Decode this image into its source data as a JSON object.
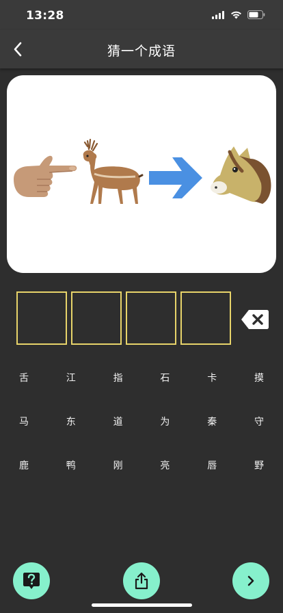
{
  "status": {
    "time": "13:28"
  },
  "nav": {
    "title": "猜一个成语"
  },
  "puzzle": {
    "emojis": [
      "pointing-hand",
      "deer",
      "right-arrow",
      "horse-face"
    ]
  },
  "answer": {
    "slots": [
      "",
      "",
      "",
      ""
    ]
  },
  "characters": {
    "rows": [
      [
        "舌",
        "江",
        "指",
        "石",
        "卡",
        "摸"
      ],
      [
        "马",
        "东",
        "道",
        "为",
        "秦",
        "守"
      ],
      [
        "鹿",
        "鸭",
        "刚",
        "亮",
        "唇",
        "野"
      ]
    ]
  },
  "colors": {
    "accent": "#86f0cc",
    "slot_border": "#e8d46a",
    "background": "#2e2e2e",
    "header": "#3a3a3a"
  },
  "icons": {
    "back": "chevron-left-icon",
    "delete": "backspace-icon",
    "hint": "question-icon",
    "share": "share-icon",
    "next": "chevron-right-icon"
  }
}
